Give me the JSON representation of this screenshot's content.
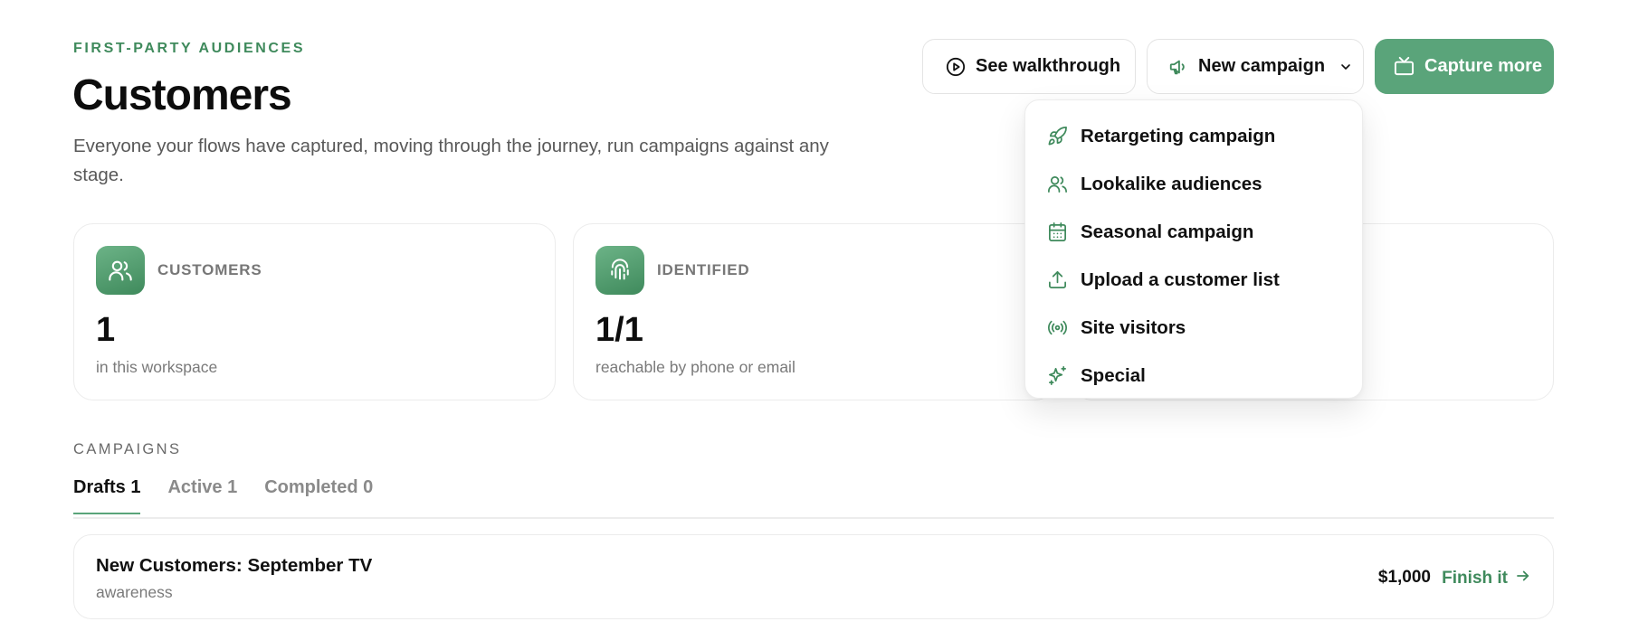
{
  "header": {
    "eyebrow": "FIRST-PARTY AUDIENCES",
    "title": "Customers",
    "description": "Everyone your flows have captured, moving through the journey, run campaigns against any stage."
  },
  "actions": {
    "walkthrough_label": "See walkthrough",
    "new_campaign_label": "New campaign",
    "capture_label": "Capture more"
  },
  "menu": {
    "items": [
      {
        "label": "Retargeting campaign",
        "icon": "rocket-icon"
      },
      {
        "label": "Lookalike audiences",
        "icon": "users-icon"
      },
      {
        "label": "Seasonal campaign",
        "icon": "calendar-icon"
      },
      {
        "label": "Upload a customer list",
        "icon": "upload-icon"
      },
      {
        "label": "Site visitors",
        "icon": "radio-signal-icon"
      },
      {
        "label": "Special",
        "icon": "sparkles-icon"
      }
    ]
  },
  "stats": [
    {
      "label": "CUSTOMERS",
      "value": "1",
      "caption": "in this workspace",
      "icon": "users-icon"
    },
    {
      "label": "IDENTIFIED",
      "value": "1/1",
      "caption": "reachable by phone or email",
      "icon": "fingerprint-icon"
    }
  ],
  "campaigns": {
    "section_label": "CAMPAIGNS",
    "tabs": [
      {
        "label": "Drafts 1",
        "active": true
      },
      {
        "label": "Active 1",
        "active": false
      },
      {
        "label": "Completed 0",
        "active": false
      }
    ],
    "rows": [
      {
        "name": "New Customers: September TV",
        "type": "awareness",
        "budget": "$1,000",
        "action": "Finish it"
      }
    ]
  },
  "colors": {
    "accent": "#5aa47a",
    "accent_dark": "#3f8a5c",
    "text": "#111111",
    "muted": "#7a7a7a",
    "border": "#ececec"
  }
}
